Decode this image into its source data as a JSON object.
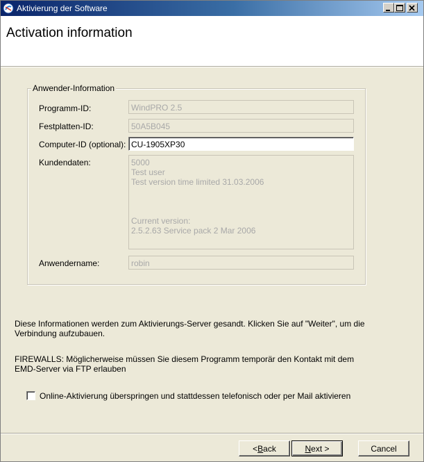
{
  "window": {
    "title": "Aktivierung der Software",
    "header_title": "Activation information"
  },
  "group": {
    "legend": "Anwender-Information",
    "fields": {
      "program_id": {
        "label": "Programm-ID:",
        "value": "WindPRO 2.5"
      },
      "disk_id": {
        "label": "Festplatten-ID:",
        "value": "50A5B045"
      },
      "computer_id": {
        "label": "Computer-ID (optional):",
        "value": "CU-1905XP30"
      },
      "customer_data": {
        "label": "Kundendaten:",
        "lines": [
          "5000",
          "Test user",
          "Test version time limited 31.03.2006",
          "",
          "",
          "",
          "Current version:",
          "2.5.2.63  Service pack 2 Mar 2006"
        ]
      },
      "username": {
        "label": "Anwendername:",
        "value": "robin"
      }
    }
  },
  "info": {
    "send_text_1": "Diese Informationen werden zum Aktivierungs-Server gesandt. Klicken Sie auf \"Weiter\", um die",
    "send_text_2": "Verbindung aufzubauen.",
    "firewall_text_1": "FIREWALLS: Möglicherweise müssen Sie diesem Programm temporär den Kontakt mit dem",
    "firewall_text_2": "EMD-Server via FTP erlauben"
  },
  "checkbox": {
    "label": "Online-Aktivierung überspringen und stattdessen telefonisch oder per Mail aktivieren",
    "checked": false
  },
  "buttons": {
    "back": {
      "prefix": "< ",
      "mnemonic": "B",
      "rest": "ack"
    },
    "next": {
      "mnemonic": "N",
      "rest": "ext >"
    },
    "cancel": "Cancel"
  }
}
